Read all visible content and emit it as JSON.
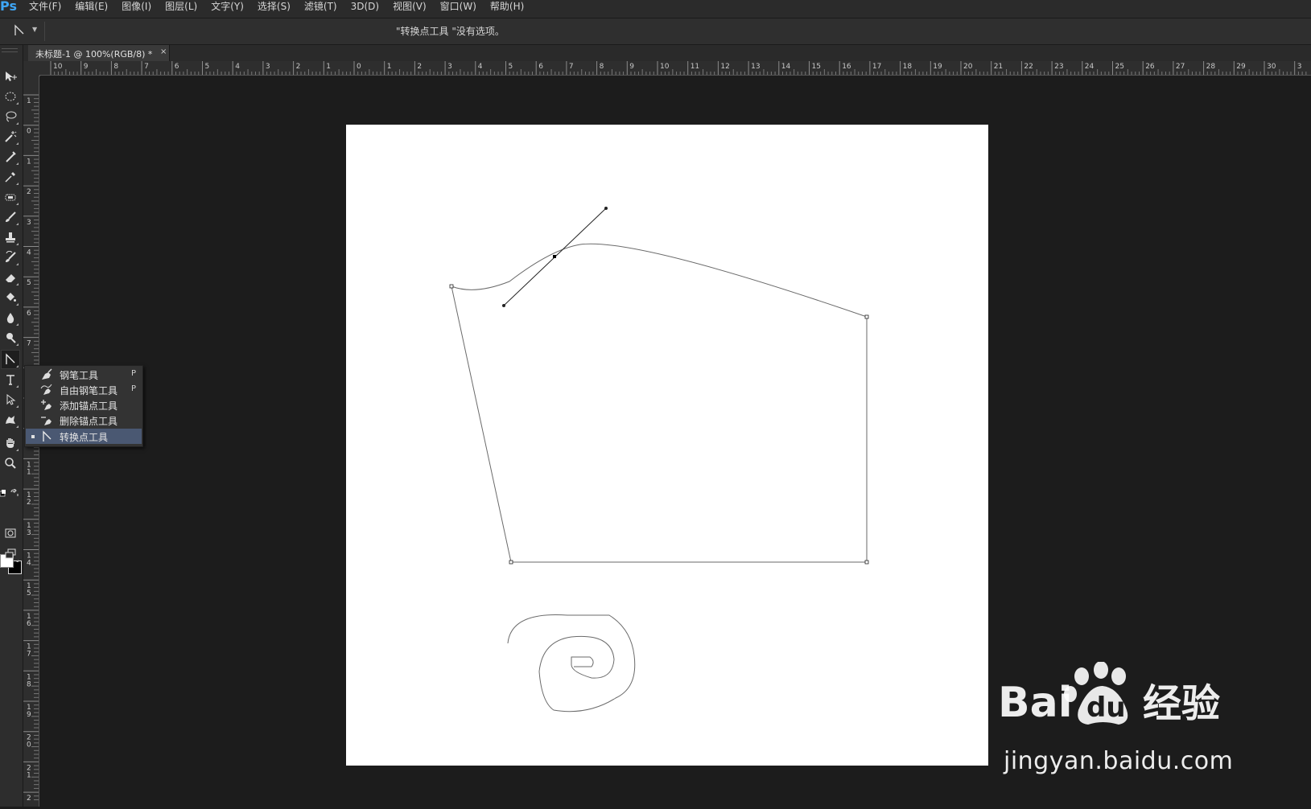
{
  "app": {
    "logo": "Ps"
  },
  "menubar": {
    "items": [
      "文件(F)",
      "编辑(E)",
      "图像(I)",
      "图层(L)",
      "文字(Y)",
      "选择(S)",
      "滤镜(T)",
      "3D(D)",
      "视图(V)",
      "窗口(W)",
      "帮助(H)"
    ]
  },
  "options": {
    "message": "\"转换点工具 \"没有选项。"
  },
  "document": {
    "tab_title": "未标题-1 @ 100%(RGB/8) *",
    "close_glyph": "×"
  },
  "rulers": {
    "top_ticks": [
      "10",
      "9",
      "8",
      "7",
      "6",
      "5",
      "4",
      "3",
      "2",
      "1",
      "0",
      "1",
      "2",
      "3",
      "4",
      "5",
      "6",
      "7",
      "8",
      "9",
      "10",
      "11",
      "12",
      "13",
      "14",
      "15",
      "16",
      "17",
      "18",
      "19",
      "20",
      "21",
      "22",
      "23",
      "24",
      "25",
      "26",
      "27",
      "28",
      "29",
      "30",
      "3"
    ],
    "left_ticks": [
      "1",
      "0",
      "1",
      "2",
      "3",
      "4",
      "5",
      "6",
      "7",
      "8",
      "9",
      "1\n0",
      "1\n1",
      "1\n2",
      "1\n3",
      "1\n4",
      "1\n5",
      "1\n6",
      "1\n7",
      "1\n8",
      "1\n9",
      "2\n0",
      "2\n1",
      "2"
    ]
  },
  "toolbar": {
    "tools": [
      "move-tool",
      "marquee-tool",
      "lasso-tool",
      "magic-wand-tool",
      "crop-tool",
      "eyedropper-tool",
      "healing-brush-tool",
      "brush-tool",
      "clone-stamp-tool",
      "history-brush-tool",
      "eraser-tool",
      "paint-bucket-tool",
      "blur-tool",
      "dodge-tool",
      "convert-point-tool",
      "type-tool",
      "path-selection-tool",
      "custom-shape-tool",
      "hand-tool",
      "zoom-tool"
    ],
    "foreground_color": "#ffffff",
    "background_color": "#000000"
  },
  "flyout": {
    "items": [
      {
        "label": "钢笔工具",
        "key": "P",
        "icon": "pen-icon",
        "selected": false
      },
      {
        "label": "自由钢笔工具",
        "key": "P",
        "icon": "freeform-pen-icon",
        "selected": false
      },
      {
        "label": "添加锚点工具",
        "key": "",
        "icon": "add-anchor-icon",
        "selected": false
      },
      {
        "label": "删除锚点工具",
        "key": "",
        "icon": "delete-anchor-icon",
        "selected": false
      },
      {
        "label": "转换点工具",
        "key": "",
        "icon": "convert-point-icon",
        "selected": true
      }
    ]
  },
  "watermark": {
    "brand_text": "Bai",
    "brand_du": "du",
    "brand_cn": "经验",
    "url": "jingyan.baidu.com"
  },
  "colors": {
    "canvas": "#ffffff",
    "workspace": "#1c1c1c",
    "accent": "#3ea6f5",
    "selection": "#4a5872"
  }
}
